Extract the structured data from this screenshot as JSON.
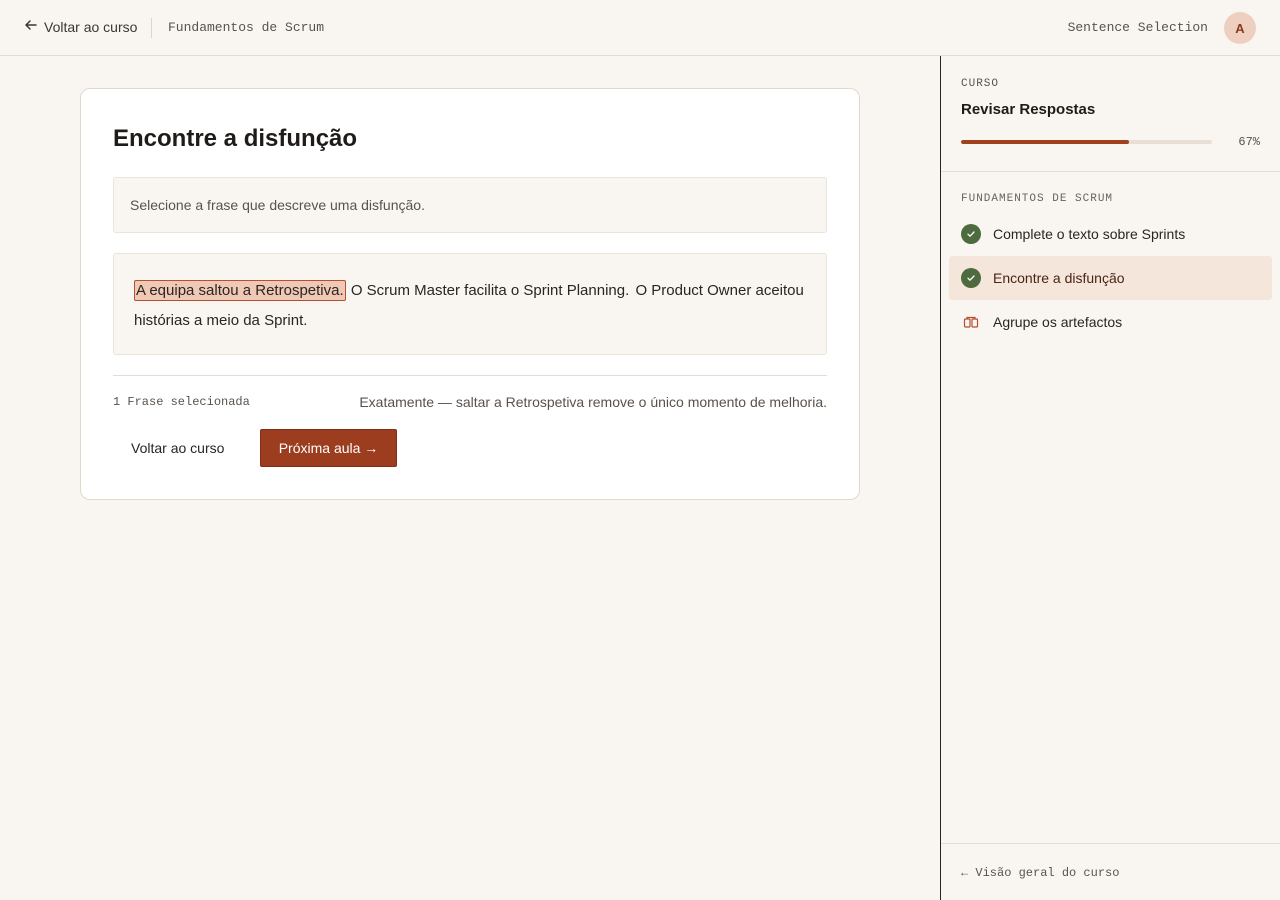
{
  "header": {
    "back_label": "Voltar ao curso",
    "course_name": "Fundamentos de Scrum",
    "mode_label": "Sentence Selection",
    "avatar_initial": "A"
  },
  "exercise": {
    "title": "Encontre a disfunção",
    "instruction": "Selecione a frase que descreve uma disfunção.",
    "sentences": [
      {
        "text": "A equipa saltou a Retrospetiva.",
        "selected": true
      },
      {
        "text": "O Scrum Master facilita o Sprint Planning.",
        "selected": false
      },
      {
        "text": "O Product Owner aceitou histórias a meio da Sprint.",
        "selected": false
      }
    ],
    "selection_count": "1 Frase selecionada",
    "feedback": "Exatamente — saltar a Retrospetiva remove o único momento de melhoria.",
    "back_button": "Voltar ao curso",
    "next_button": "Próxima aula →"
  },
  "sidebar": {
    "kicker": "CURSO",
    "title": "Revisar Respostas",
    "progress_percent": 67,
    "progress_label": "67%",
    "section_title": "FUNDAMENTOS DE SCRUM",
    "lessons": [
      {
        "label": "Complete o texto sobre Sprints",
        "status": "done"
      },
      {
        "label": "Encontre a disfunção",
        "status": "done",
        "active": true
      },
      {
        "label": "Agrupe os artefactos",
        "status": "todo"
      }
    ],
    "footer_link": "← Visão geral do curso"
  },
  "colors": {
    "accent": "#9b3d1e",
    "highlight": "#f0c8b6",
    "done": "#4d6b3f",
    "background": "#f9f6f1"
  }
}
